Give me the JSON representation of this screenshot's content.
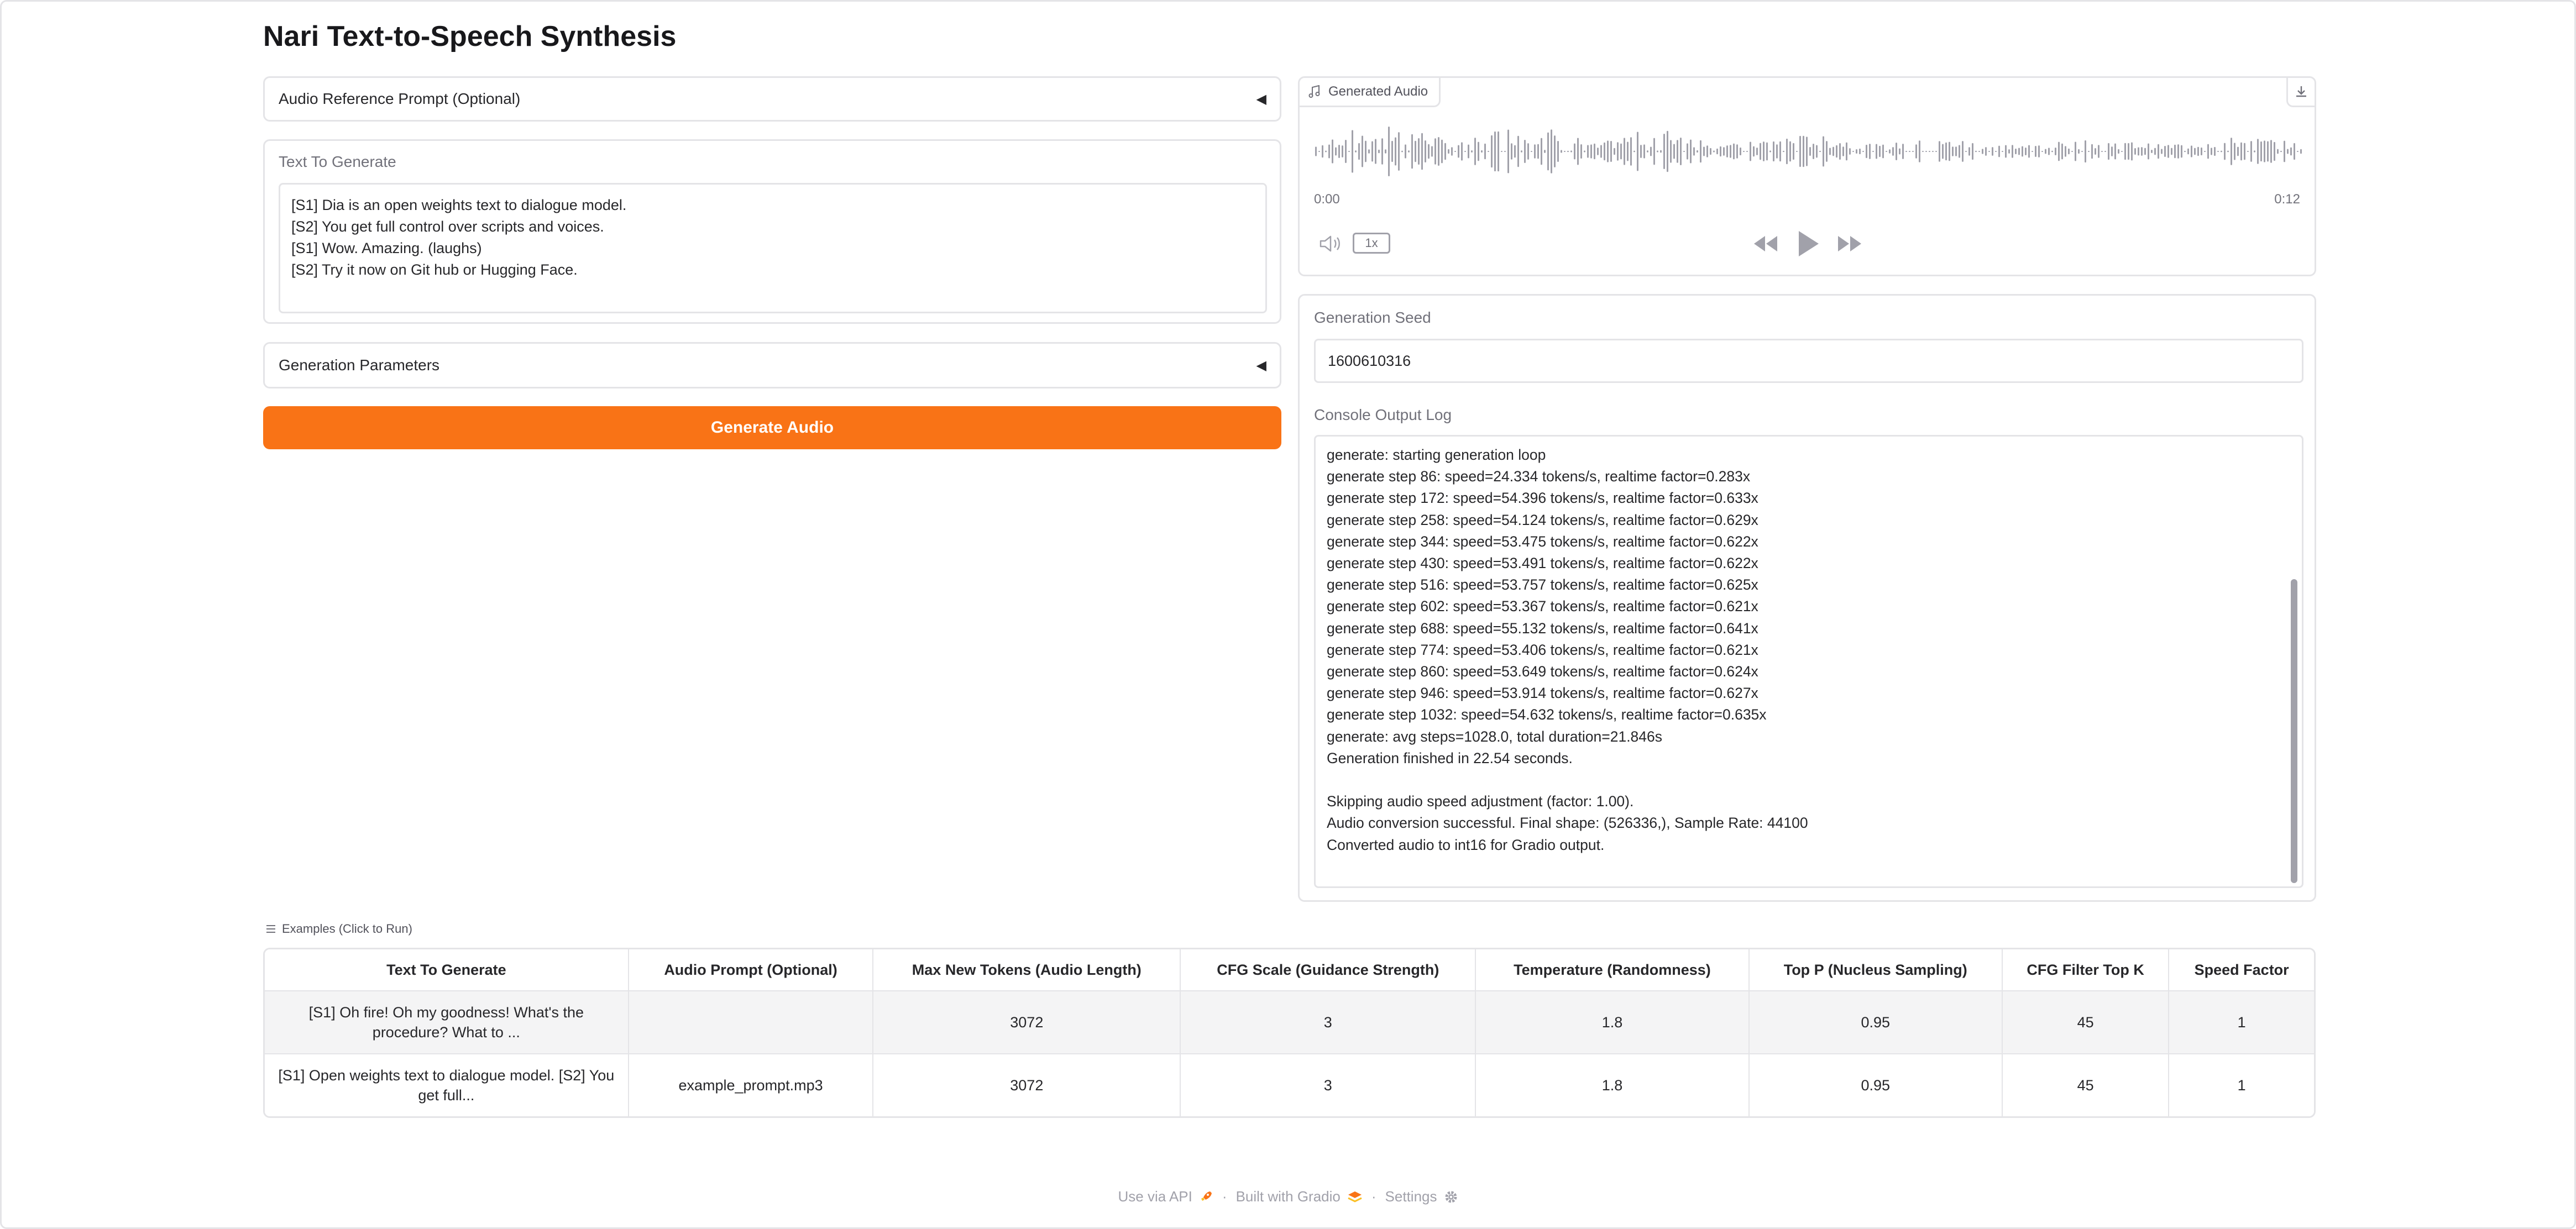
{
  "app": {
    "title": "Nari Text-to-Speech Synthesis"
  },
  "left": {
    "audio_prompt_accordion": {
      "label": "Audio Reference Prompt (Optional)",
      "icon": "caret-left-icon"
    },
    "text_input": {
      "label": "Text To Generate",
      "value": "[S1] Dia is an open weights text to dialogue model.\n[S2] You get full control over scripts and voices.\n[S1] Wow. Amazing. (laughs)\n[S2] Try it now on Git hub or Hugging Face."
    },
    "params_accordion": {
      "label": "Generation Parameters",
      "icon": "caret-left-icon"
    },
    "generate_button": {
      "label": "Generate Audio"
    }
  },
  "audio_player": {
    "label": "Generated Audio",
    "current_time": "0:00",
    "duration": "0:12",
    "playback_rate": "1x",
    "icons": {
      "label": "music-note-icon",
      "download": "download-icon",
      "volume": "volume-icon",
      "rewind": "rewind-icon",
      "play": "play-icon",
      "forward": "fast-forward-icon"
    },
    "color": "#a1a1aa"
  },
  "seed": {
    "label": "Generation Seed",
    "value": "1600610316"
  },
  "console": {
    "label": "Console Output Log",
    "lines": [
      "generate: starting generation loop",
      "generate step 86: speed=24.334 tokens/s, realtime factor=0.283x",
      "generate step 172: speed=54.396 tokens/s, realtime factor=0.633x",
      "generate step 258: speed=54.124 tokens/s, realtime factor=0.629x",
      "generate step 344: speed=53.475 tokens/s, realtime factor=0.622x",
      "generate step 430: speed=53.491 tokens/s, realtime factor=0.622x",
      "generate step 516: speed=53.757 tokens/s, realtime factor=0.625x",
      "generate step 602: speed=53.367 tokens/s, realtime factor=0.621x",
      "generate step 688: speed=55.132 tokens/s, realtime factor=0.641x",
      "generate step 774: speed=53.406 tokens/s, realtime factor=0.621x",
      "generate step 860: speed=53.649 tokens/s, realtime factor=0.624x",
      "generate step 946: speed=53.914 tokens/s, realtime factor=0.627x",
      "generate step 1032: speed=54.632 tokens/s, realtime factor=0.635x",
      "generate: avg steps=1028.0, total duration=21.846s",
      "Generation finished in 22.54 seconds.",
      "",
      "Skipping audio speed adjustment (factor: 1.00).",
      "Audio conversion successful. Final shape: (526336,), Sample Rate: 44100",
      "Converted audio to int16 for Gradio output."
    ]
  },
  "examples": {
    "label": "Examples (Click to Run)",
    "icon": "list-icon",
    "headers": [
      "Text To Generate",
      "Audio Prompt (Optional)",
      "Max New Tokens (Audio Length)",
      "CFG Scale (Guidance Strength)",
      "Temperature (Randomness)",
      "Top P (Nucleus Sampling)",
      "CFG Filter Top K",
      "Speed Factor"
    ],
    "rows": [
      [
        "[S1] Oh fire! Oh my goodness! What's the procedure? What to ...",
        "",
        "3072",
        "3",
        "1.8",
        "0.95",
        "45",
        "1"
      ],
      [
        "[S1] Open weights text to dialogue model. [S2] You get full...",
        "example_prompt.mp3",
        "3072",
        "3",
        "1.8",
        "0.95",
        "45",
        "1"
      ]
    ]
  },
  "footer": {
    "api": "Use via API",
    "built": "Built with Gradio",
    "settings": "Settings",
    "separator": "·",
    "icons": [
      "rocket-icon",
      "gradio-logo-icon",
      "gear-icon"
    ]
  },
  "colors": {
    "accent": "#f97316",
    "border": "#e4e4e7",
    "muted": "#71717a"
  }
}
